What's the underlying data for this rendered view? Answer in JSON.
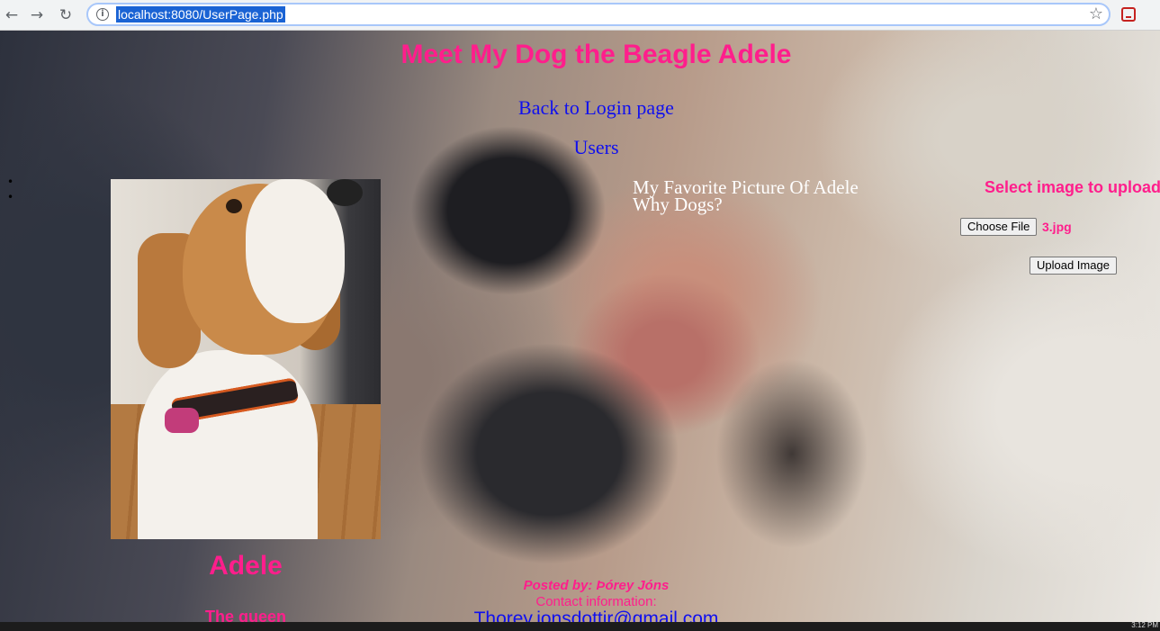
{
  "browser": {
    "url": "localhost:8080/UserPage.php"
  },
  "page": {
    "title": "Meet My Dog the Beagle Adele",
    "links": {
      "login": "Back to Login page",
      "users": "Users"
    },
    "bullets": [
      "•",
      "•"
    ],
    "photo": {
      "caption": "Adele",
      "subcaption": "The queen"
    },
    "favorite": {
      "line1": "My Favorite Picture Of Adele",
      "line2": "Why Dogs?"
    },
    "upload": {
      "title": "Select image to upload",
      "choose_label": "Choose File",
      "file_name": "3.jpg",
      "upload_label": "Upload Image"
    },
    "footer": {
      "posted_by": "Posted by: Þórey Jóns",
      "contact": "Contact information:",
      "email": "Thorey.jonsdottir@gmail.com"
    }
  },
  "taskbar": {
    "clock": "3:12 PM"
  }
}
